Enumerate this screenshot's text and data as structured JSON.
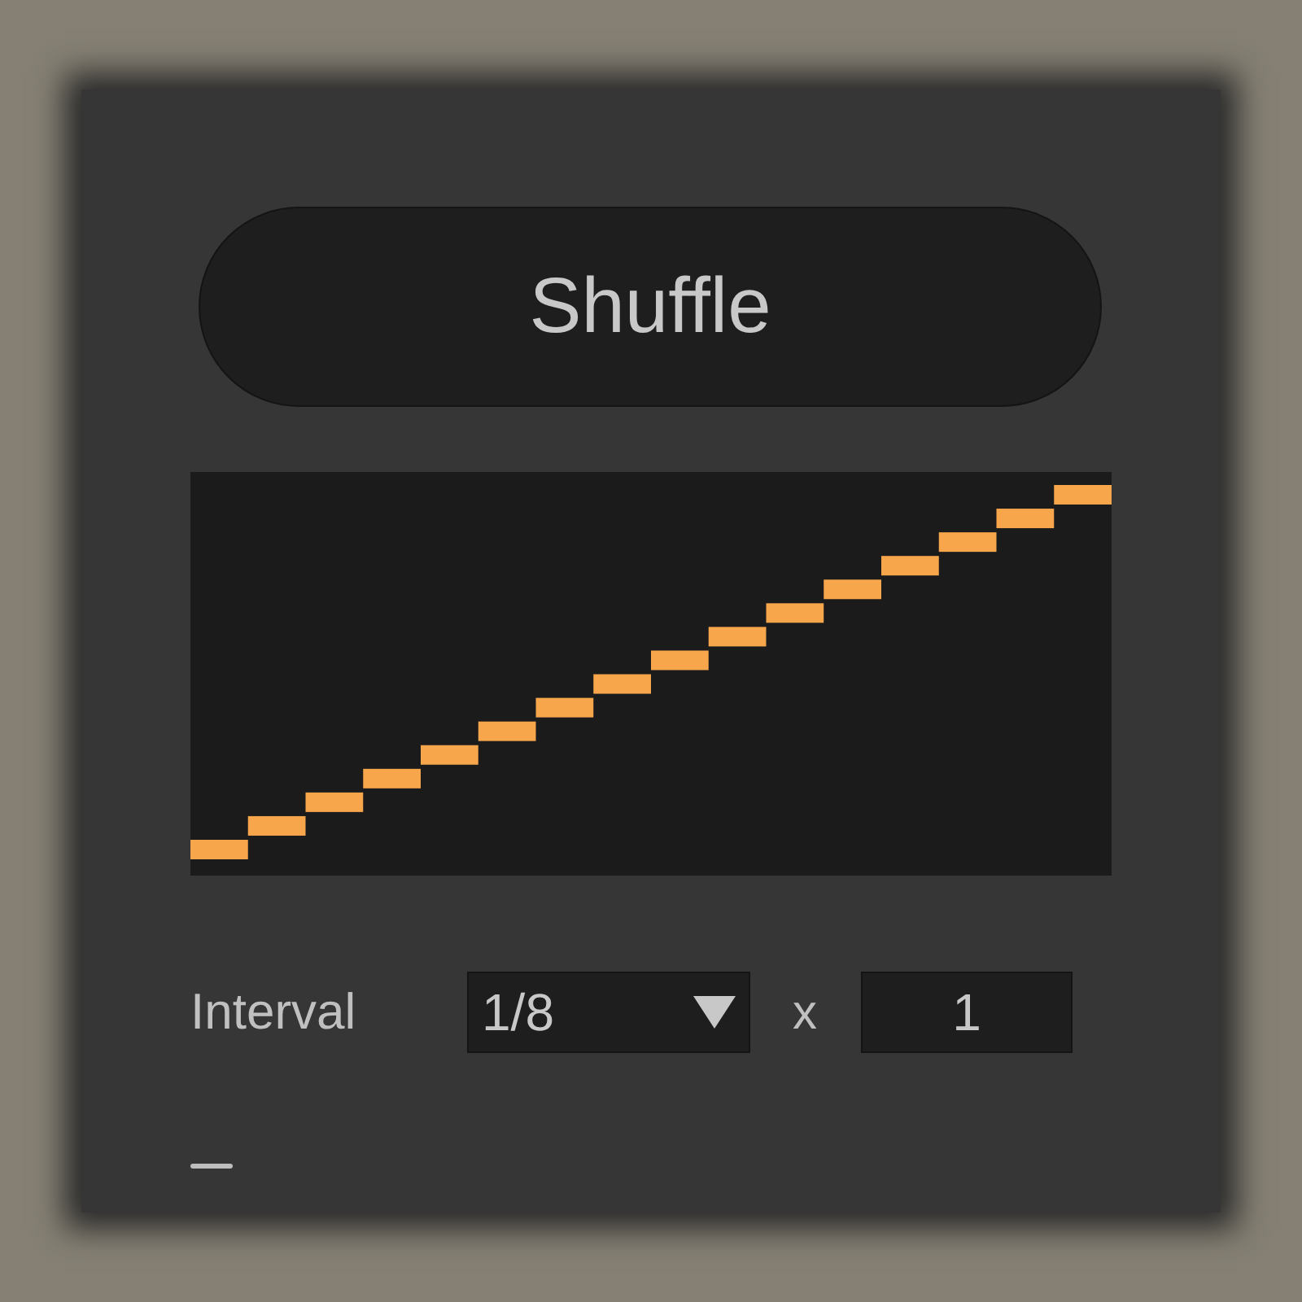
{
  "title_button": {
    "label": "Shuffle"
  },
  "interval": {
    "label": "Interval",
    "dropdown": {
      "value": "1/8"
    },
    "multiplier_sign": "x",
    "multiplier": {
      "value": "1"
    }
  }
}
